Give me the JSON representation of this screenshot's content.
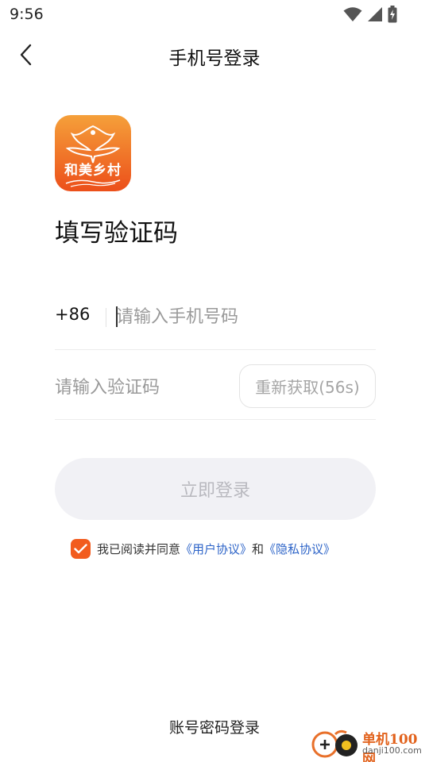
{
  "status_bar": {
    "time": "9:56",
    "icons": [
      "wifi-icon",
      "signal-icon",
      "battery-charging-icon"
    ]
  },
  "header": {
    "title": "手机号登录",
    "back_icon": "chevron-left-icon"
  },
  "logo": {
    "text": "和美乡村",
    "colors": {
      "top": "#f5a03a",
      "bottom": "#ec4f1a"
    }
  },
  "heading": "填写验证码",
  "phone": {
    "country_code": "+86",
    "placeholder": "请输入手机号码",
    "value": ""
  },
  "code": {
    "placeholder": "请输入验证码",
    "value": "",
    "resend_label": "重新获取(56s)"
  },
  "login_button": "立即登录",
  "agreement": {
    "checked": true,
    "prefix": "我已阅读并同意",
    "user_agreement": "《用户协议》",
    "and": "和",
    "privacy_policy": "《隐私协议》",
    "link_color": "#2d64c8",
    "accent_color": "#f25c1e"
  },
  "account_login": "账号密码登录",
  "watermark": {
    "cn": "单机100网",
    "en": "danji100.com"
  }
}
